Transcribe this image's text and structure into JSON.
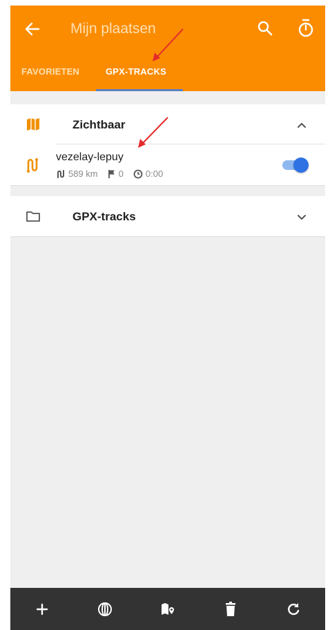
{
  "appbar": {
    "title": "Mijn plaatsen",
    "back_icon": "arrow-left-icon",
    "actions": [
      "search-icon",
      "timer-icon"
    ],
    "background": "#fb8c00"
  },
  "tabs": [
    {
      "label": "FAVORIETEN",
      "active": false
    },
    {
      "label": "GPX-TRACKS",
      "active": true
    }
  ],
  "groups": {
    "visible": {
      "title": "Zichtbaar",
      "icon": "map-icon",
      "expanded": true,
      "tracks": [
        {
          "name": "vezelay-lepuy",
          "distance": "589 km",
          "waypoints": "0",
          "duration": "0:00",
          "visible": true
        }
      ]
    },
    "gpx": {
      "title": "GPX-tracks",
      "icon": "folder-icon",
      "expanded": false
    }
  },
  "bottombar": {
    "buttons": [
      "add-icon",
      "globe-icon",
      "map-marker-icon",
      "trash-icon",
      "refresh-icon"
    ]
  },
  "colors": {
    "accent": "#fb8c00",
    "toggle_on": "#2f72e4",
    "tab_indicator": "#5c7fbf",
    "annotation": "#e52b2b"
  }
}
